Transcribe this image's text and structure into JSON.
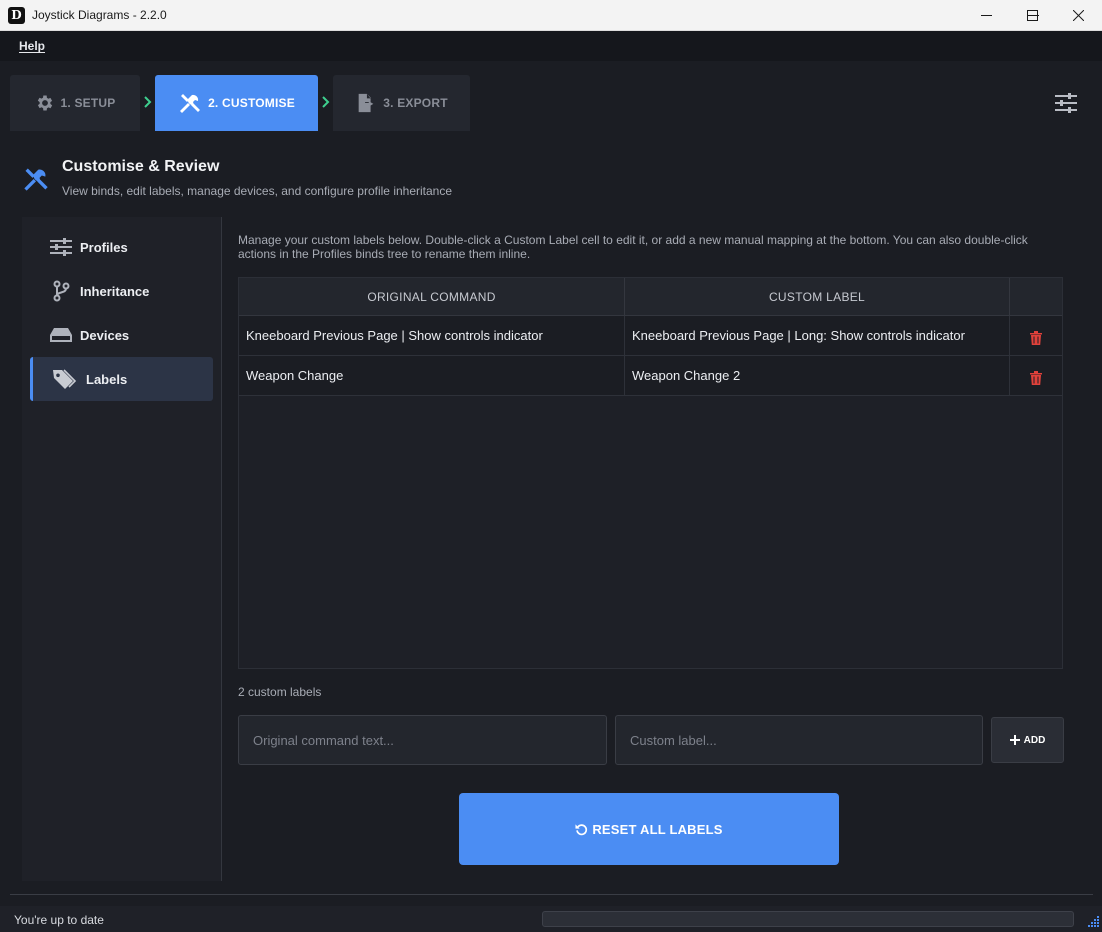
{
  "window": {
    "title": "Joystick Diagrams - 2.2.0",
    "app_icon_letter": "D"
  },
  "menu": {
    "help": "Help"
  },
  "steps": [
    {
      "label": "1. SETUP",
      "icon": "gear-icon",
      "state": "inactive"
    },
    {
      "label": "2. CUSTOMISE",
      "icon": "tools-icon",
      "state": "active"
    },
    {
      "label": "3. EXPORT",
      "icon": "file-export-icon",
      "state": "inactive"
    }
  ],
  "header": {
    "title": "Customise & Review",
    "subtitle": "View binds, edit labels, manage devices, and configure profile inheritance"
  },
  "sidebar": {
    "items": [
      {
        "label": "Profiles",
        "icon": "sliders-icon",
        "selected": false
      },
      {
        "label": "Inheritance",
        "icon": "branch-icon",
        "selected": false
      },
      {
        "label": "Devices",
        "icon": "hard-drive-icon",
        "selected": false
      },
      {
        "label": "Labels",
        "icon": "tags-icon",
        "selected": true
      }
    ]
  },
  "labels_page": {
    "hint": "Manage your custom labels below. Double-click a Custom Label cell to edit it, or add a new manual mapping at the bottom. You can also double-click actions in the Profiles binds tree to rename them inline.",
    "table": {
      "columns": [
        "ORIGINAL COMMAND",
        "CUSTOM LABEL",
        ""
      ],
      "rows": [
        {
          "original": "Kneeboard Previous Page | Show controls indicator",
          "custom": "Kneeboard Previous Page | Long: Show controls indicator"
        },
        {
          "original": "Weapon Change",
          "custom": "Weapon Change 2"
        }
      ]
    },
    "count_text": "2 custom labels",
    "original_input": {
      "placeholder": "Original command text...",
      "value": ""
    },
    "custom_input": {
      "placeholder": "Custom label...",
      "value": ""
    },
    "add_label": "ADD",
    "reset_label": "RESET ALL LABELS"
  },
  "status": {
    "text": "You're up to date",
    "progress": 0
  },
  "colors": {
    "accent": "#4b8df3",
    "background": "#1b1d23",
    "danger": "#e0413b",
    "step_arrow": "#3ecf8e"
  }
}
